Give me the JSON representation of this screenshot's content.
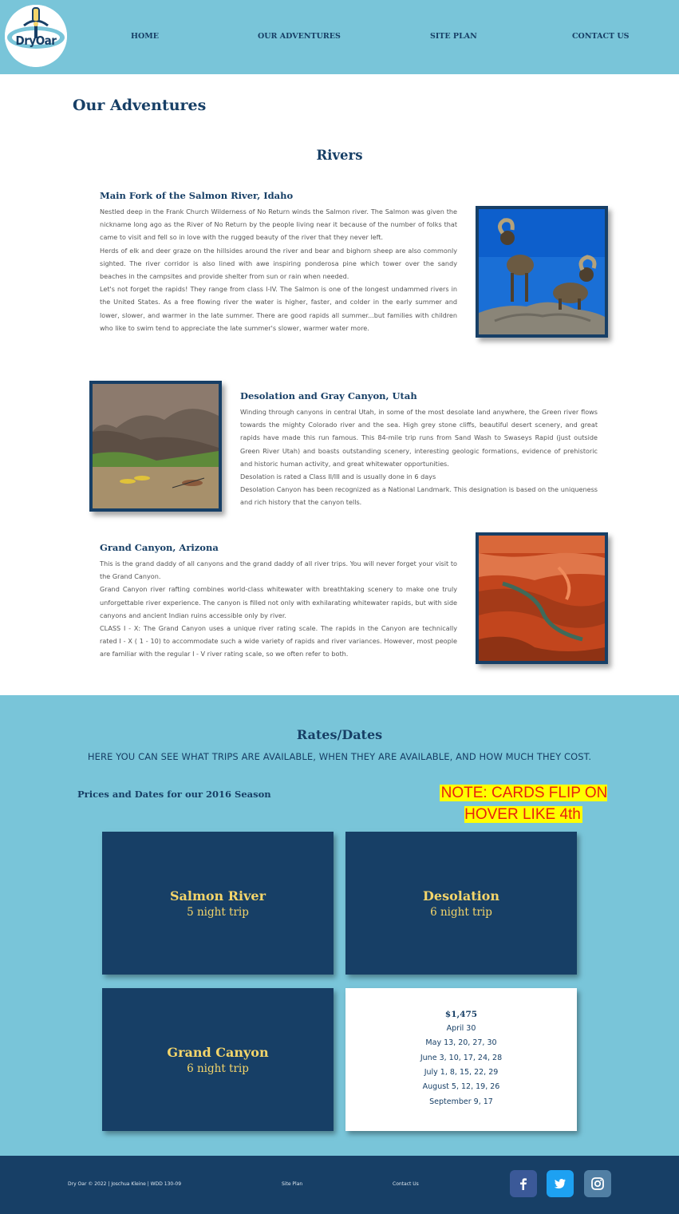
{
  "header": {
    "logo_text": "DryOar",
    "nav": [
      "HOME",
      "OUR ADVENTURES",
      "SITE PLAN",
      "CONTACT US"
    ]
  },
  "page_title": "Our Adventures",
  "rivers": {
    "title": "Rivers",
    "items": [
      {
        "heading": "Main Fork of the Salmon River, Idaho",
        "paragraphs": [
          "Nestled deep in the Frank Church Wilderness of No Return winds the Salmon river. The Salmon was given the nickname long ago as the River of No Return by the people living near it because of the number of folks that came to visit and fell so in love with the rugged beauty of the river that they never left.",
          "Herds of elk and deer graze on the hillsides around the river and bear and bighorn sheep are also commonly sighted. The river corridor is also lined with awe inspiring ponderosa pine which tower over the sandy beaches in the campsites and provide shelter from sun or rain when needed.",
          "Let's not forget the rapids! They range from class I-IV. The Salmon is one of the longest undammed rivers in the United States. As a free flowing river the water is higher, faster, and colder in the early summer and lower, slower, and warmer in the late summer. There are good rapids all summer...but families with children who like to swim tend to appreciate the late summer's slower, warmer water more."
        ]
      },
      {
        "heading": "Desolation and Gray Canyon, Utah",
        "paragraphs": [
          "Winding through canyons in central Utah, in some of the most desolate land anywhere, the Green river flows towards the mighty Colorado river and the sea. High grey stone cliffs, beautiful desert scenery, and great rapids have made this run famous. This 84-mile trip runs from Sand Wash to Swaseys Rapid (just outside Green River Utah) and boasts outstanding scenery, interesting geologic formations, evidence of prehistoric and historic human activity, and great whitewater opportunities.",
          "Desolation is rated a Class II/III and is usually done in 6 days",
          "Desolation Canyon has been recognized as a National Landmark.  This designation is based on the uniqueness and rich history that the canyon tells."
        ]
      },
      {
        "heading": "Grand Canyon, Arizona",
        "paragraphs": [
          "This is the grand daddy of all canyons and the grand daddy of all river trips. You will never forget your visit to the Grand Canyon.",
          "Grand Canyon river rafting combines world-class whitewater with breathtaking scenery to make one truly unforgettable river experience. The canyon is filled not only with exhilarating whitewater rapids, but with side canyons and ancient Indian ruins accessible only by river.",
          "CLASS I - X: The Grand Canyon uses a unique river rating scale. The rapids in the Canyon are technically rated I - X ( 1 - 10) to accommodate such a wide variety of rapids and river variances. However, most people are familiar with the regular I - V river rating scale, so we often refer to both."
        ]
      }
    ]
  },
  "rates": {
    "title": "Rates/Dates",
    "subtitle": "HERE YOU CAN SEE WHAT TRIPS ARE AVAILABLE, WHEN THEY ARE AVAILABLE, AND HOW MUCH THEY COST.",
    "season": "Prices and Dates for our 2016 Season",
    "note": "NOTE: CARDS FLIP ON HOVER LIKE 4th",
    "cards": [
      {
        "name": "Salmon River",
        "nights": "5 night trip"
      },
      {
        "name": "Desolation",
        "nights": "6 night trip"
      },
      {
        "name": "Grand Canyon",
        "nights": "6 night trip"
      }
    ],
    "flipped_card": {
      "price": "$1,475",
      "dates": [
        "April 30",
        "May 13, 20, 27, 30",
        "June 3, 10, 17, 24, 28",
        "July 1, 8, 15, 22, 29",
        "August 5, 12, 19, 26",
        "September 9, 17"
      ]
    }
  },
  "footer": {
    "copyright": "Dry Oar © 2022 | Joschua Kleine | WDD 130-09",
    "site_plan": "Site Plan",
    "contact": "Contact Us",
    "social": [
      {
        "icon": "facebook-icon",
        "color": "#3b5998"
      },
      {
        "icon": "twitter-icon",
        "color": "#1da1f2"
      },
      {
        "icon": "instagram-icon",
        "color": "#517fa4"
      }
    ]
  },
  "colors": {
    "header_bg": "#79c5d9",
    "navy": "#173f66",
    "card_gold": "#f4d56a",
    "note_red": "#e8210d",
    "note_highlight": "#ffff00"
  }
}
